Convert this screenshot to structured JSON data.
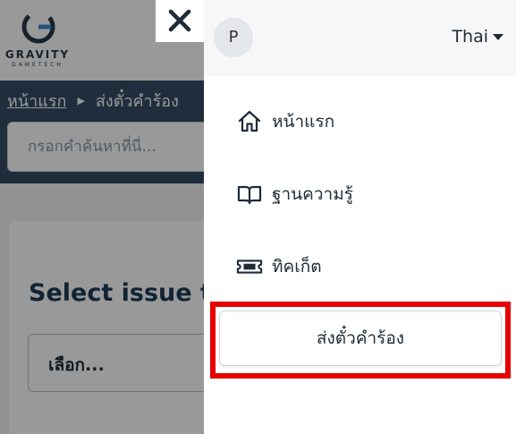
{
  "brand": {
    "name": "GRAVITY",
    "tagline": "GAMETECH"
  },
  "breadcrumb": {
    "home": "หน้าแรก",
    "current": "ส่งตั๋วคำร้อง"
  },
  "search": {
    "placeholder": "กรอกคำค้นหาที่นี่..."
  },
  "form": {
    "title": "Select issue ty",
    "select_value": "เลือก..."
  },
  "drawer": {
    "avatar_initial": "P",
    "language": "Thai",
    "nav": [
      {
        "label": "หน้าแรก",
        "icon": "home-icon"
      },
      {
        "label": "ฐานความรู้",
        "icon": "book-icon"
      },
      {
        "label": "ทิคเก็ต",
        "icon": "ticket-icon"
      }
    ],
    "submit_label": "ส่งตั๋วคำร้อง"
  },
  "colors": {
    "hero": "#344b66",
    "highlight": "#e60000",
    "title": "#1f3c57"
  }
}
